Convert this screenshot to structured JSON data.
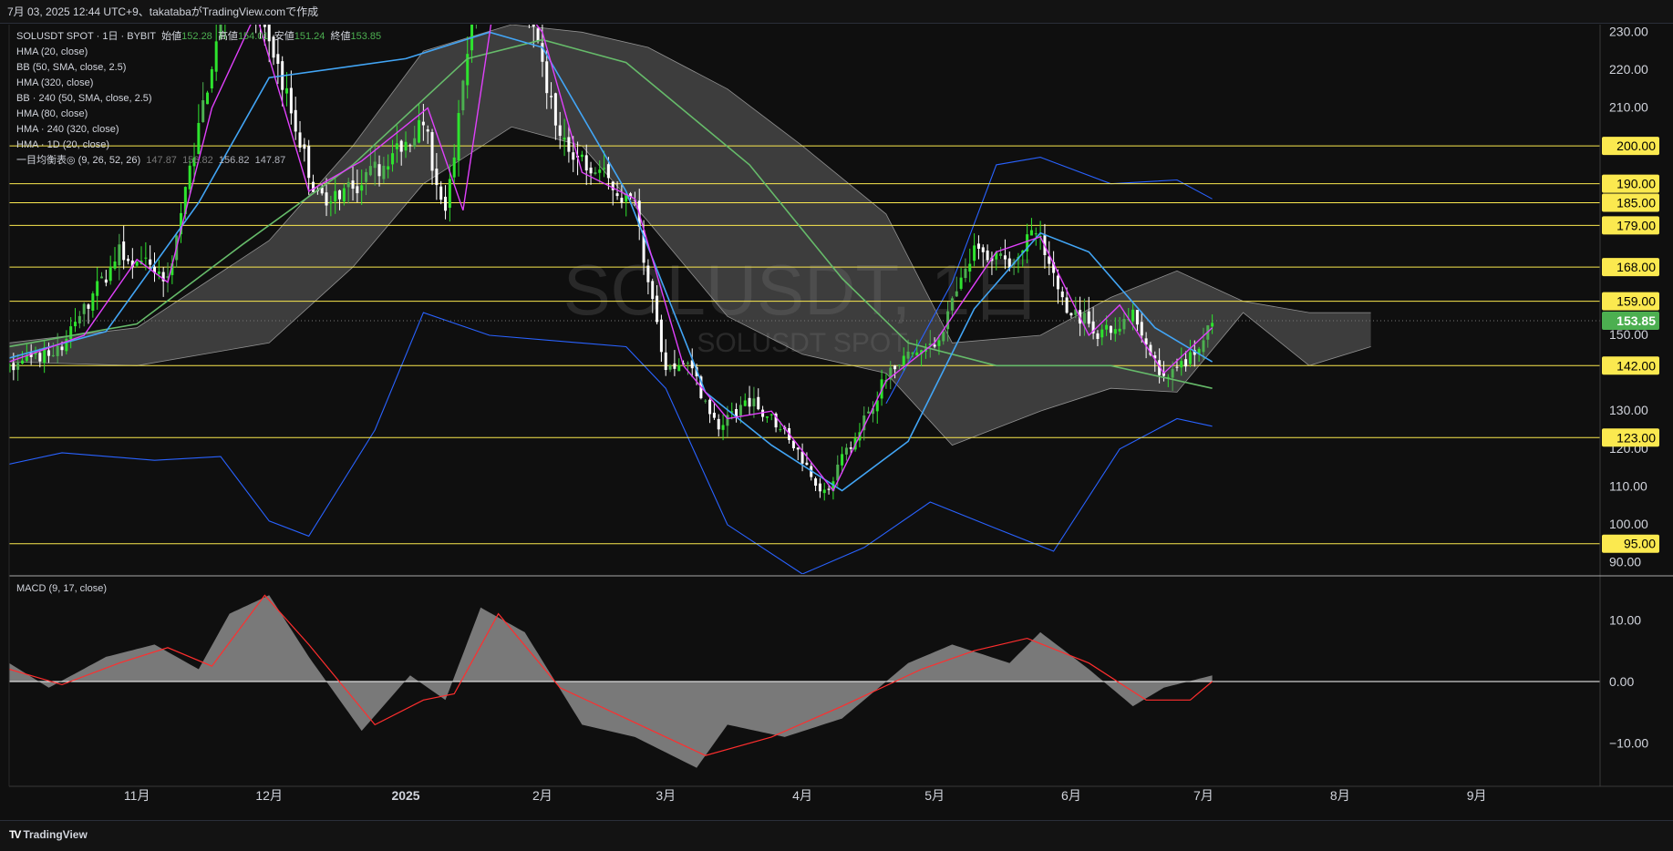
{
  "header": {
    "caption": "7月 03, 2025 12:44 UTC+9、takatabaがTradingView.comで作成"
  },
  "legend": {
    "symbol_line": "SOLUSDT SPOT · 1日 · BYBIT",
    "open_label": "始値",
    "open": "152.28",
    "high_label": "高値",
    "high": "154.01",
    "low_label": "安値",
    "low": "151.24",
    "close_label": "終値",
    "close": "153.85",
    "indicators": [
      "HMA (20, close)",
      "BB (50, SMA, close, 2.5)",
      "HMA (320, close)",
      "BB · 240 (50, SMA, close, 2.5)",
      "HMA (80, close)",
      "HMA · 240 (320, close)",
      "HMA · 1D (20, close)"
    ],
    "ichimoku_label": "一目均衡表◎ (9, 26, 52, 26)",
    "ichimoku_values": [
      "147.87",
      "156.82",
      "156.82",
      "147.87"
    ]
  },
  "watermark": {
    "big": "SOLUSDT, 1日",
    "small": "SOLUSDT SPOT"
  },
  "macd_label": "MACD (9, 17, close)",
  "footer": {
    "logo_text": "TradingView"
  },
  "colors": {
    "background": "#0f0f0f",
    "up": "#4caf50",
    "up_bright": "#2ee32e",
    "down": "#ffffff",
    "hma20": "#e040fb",
    "hma80": "#42a5f5",
    "hma320": "#66bb6a",
    "bb": "#2962ff",
    "level": "#fbe94f",
    "cloud": "#888888",
    "macd_signal": "#ff2e2e",
    "macd_hist": "#9e9e9e",
    "price_tag": "#4caf50"
  },
  "chart_data": {
    "type": "candlestick",
    "title": "SOLUSDT SPOT · 1日 · BYBIT",
    "price_axis": {
      "ticks": [
        230,
        220,
        210,
        200,
        190,
        180,
        170,
        160,
        150,
        140,
        130,
        120,
        110,
        100,
        90
      ],
      "tick_labels": [
        "230.00",
        "220.00",
        "210.00",
        "200.00",
        "",
        "",
        "",
        "",
        "150.00",
        "",
        "130.00",
        "120.00",
        "110.00",
        "100.00",
        "90.00"
      ],
      "ylim": [
        87,
        232
      ]
    },
    "time_axis": {
      "labels": [
        "11月",
        "12月",
        "2025",
        "2月",
        "3月",
        "4月",
        "5月",
        "6月",
        "7月",
        "8月",
        "9月"
      ],
      "positions": [
        "2024-11-01",
        "2024-12-01",
        "2025-01-01",
        "2025-02-01",
        "2025-03-01",
        "2025-04-01",
        "2025-05-01",
        "2025-06-01",
        "2025-07-01",
        "2025-08-01",
        "2025-09-01"
      ],
      "xlim": [
        "2024-10-03",
        "2025-09-29"
      ]
    },
    "horizontal_levels": [
      200,
      190,
      185,
      179,
      168,
      159,
      142,
      123,
      95
    ],
    "horizontal_level_labels": [
      "200.00",
      "190.00",
      "185.00",
      "179.00",
      "168.00",
      "159.00",
      "142.00",
      "123.00",
      "95.00"
    ],
    "last_price": 153.85,
    "last_price_label": "153.85",
    "price_path": [
      [
        "2024-10-03",
        141
      ],
      [
        "2024-10-15",
        147
      ],
      [
        "2024-10-28",
        172
      ],
      [
        "2024-11-08",
        165
      ],
      [
        "2024-11-22",
        245
      ],
      [
        "2024-12-01",
        228
      ],
      [
        "2024-12-12",
        186
      ],
      [
        "2024-12-22",
        190
      ],
      [
        "2025-01-05",
        206
      ],
      [
        "2025-01-10",
        181
      ],
      [
        "2025-01-19",
        258
      ],
      [
        "2025-01-28",
        238
      ],
      [
        "2025-02-05",
        202
      ],
      [
        "2025-02-15",
        192
      ],
      [
        "2025-02-22",
        183
      ],
      [
        "2025-03-01",
        141
      ],
      [
        "2025-03-06",
        143
      ],
      [
        "2025-03-13",
        125
      ],
      [
        "2025-03-20",
        133
      ],
      [
        "2025-03-28",
        125
      ],
      [
        "2025-04-06",
        108
      ],
      [
        "2025-04-13",
        124
      ],
      [
        "2025-04-22",
        143
      ],
      [
        "2025-05-01",
        147
      ],
      [
        "2025-05-10",
        172
      ],
      [
        "2025-05-18",
        170
      ],
      [
        "2025-05-24",
        177
      ],
      [
        "2025-05-30",
        159
      ],
      [
        "2025-06-08",
        150
      ],
      [
        "2025-06-15",
        155
      ],
      [
        "2025-06-22",
        138
      ],
      [
        "2025-06-27",
        143
      ],
      [
        "2025-07-03",
        153.85
      ]
    ],
    "hma20": [
      [
        "2024-10-03",
        143
      ],
      [
        "2024-10-20",
        150
      ],
      [
        "2024-11-01",
        170
      ],
      [
        "2024-11-08",
        164
      ],
      [
        "2024-11-18",
        210
      ],
      [
        "2024-11-28",
        235
      ],
      [
        "2024-12-10",
        188
      ],
      [
        "2024-12-22",
        196
      ],
      [
        "2025-01-06",
        210
      ],
      [
        "2025-01-14",
        183
      ],
      [
        "2025-01-22",
        245
      ],
      [
        "2025-02-01",
        230
      ],
      [
        "2025-02-10",
        193
      ],
      [
        "2025-02-22",
        186
      ],
      [
        "2025-03-05",
        142
      ],
      [
        "2025-03-15",
        128
      ],
      [
        "2025-03-25",
        130
      ],
      [
        "2025-04-08",
        109
      ],
      [
        "2025-04-20",
        138
      ],
      [
        "2025-05-01",
        148
      ],
      [
        "2025-05-15",
        172
      ],
      [
        "2025-05-25",
        176
      ],
      [
        "2025-06-05",
        150
      ],
      [
        "2025-06-12",
        158
      ],
      [
        "2025-06-22",
        140
      ],
      [
        "2025-07-03",
        152
      ]
    ],
    "hma80": [
      [
        "2024-10-03",
        144
      ],
      [
        "2024-10-25",
        151
      ],
      [
        "2024-11-15",
        185
      ],
      [
        "2024-12-01",
        218
      ],
      [
        "2025-01-01",
        223
      ],
      [
        "2025-01-20",
        230
      ],
      [
        "2025-02-01",
        226
      ],
      [
        "2025-02-20",
        188
      ],
      [
        "2025-03-10",
        135
      ],
      [
        "2025-03-25",
        121
      ],
      [
        "2025-04-10",
        109
      ],
      [
        "2025-04-25",
        122
      ],
      [
        "2025-05-10",
        157
      ],
      [
        "2025-05-25",
        177
      ],
      [
        "2025-06-05",
        172
      ],
      [
        "2025-06-20",
        152
      ],
      [
        "2025-07-03",
        143
      ]
    ],
    "hma320": [
      [
        "2024-10-03",
        147
      ],
      [
        "2024-11-01",
        153
      ],
      [
        "2024-11-25",
        174
      ],
      [
        "2024-12-20",
        195
      ],
      [
        "2025-01-15",
        223
      ],
      [
        "2025-02-01",
        228
      ],
      [
        "2025-02-20",
        222
      ],
      [
        "2025-03-20",
        195
      ],
      [
        "2025-04-10",
        165
      ],
      [
        "2025-04-25",
        148
      ],
      [
        "2025-05-15",
        142
      ],
      [
        "2025-06-10",
        142
      ],
      [
        "2025-07-03",
        136
      ]
    ],
    "bb_upper": [
      [
        "2025-04-20",
        132
      ],
      [
        "2025-05-05",
        164
      ],
      [
        "2025-05-15",
        195
      ],
      [
        "2025-05-25",
        197
      ],
      [
        "2025-06-10",
        190
      ],
      [
        "2025-06-25",
        191
      ],
      [
        "2025-07-03",
        186
      ]
    ],
    "bb_lower": [
      [
        "2024-10-03",
        116
      ],
      [
        "2024-10-15",
        119
      ],
      [
        "2024-11-05",
        117
      ],
      [
        "2024-11-20",
        118
      ],
      [
        "2024-12-01",
        101
      ],
      [
        "2024-12-10",
        97
      ],
      [
        "2024-12-25",
        125
      ],
      [
        "2025-01-05",
        156
      ],
      [
        "2025-01-20",
        150
      ],
      [
        "2025-02-20",
        147
      ],
      [
        "2025-03-01",
        136
      ],
      [
        "2025-03-15",
        100
      ],
      [
        "2025-04-01",
        87
      ],
      [
        "2025-04-15",
        94
      ],
      [
        "2025-04-30",
        106
      ],
      [
        "2025-05-15",
        99
      ],
      [
        "2025-05-28",
        93
      ],
      [
        "2025-06-12",
        120
      ],
      [
        "2025-06-25",
        128
      ],
      [
        "2025-07-03",
        126
      ]
    ],
    "cloud_upper": [
      [
        "2024-10-03",
        148
      ],
      [
        "2024-11-01",
        152
      ],
      [
        "2024-12-01",
        175
      ],
      [
        "2024-12-20",
        200
      ],
      [
        "2025-01-05",
        225
      ],
      [
        "2025-01-25",
        232
      ],
      [
        "2025-02-10",
        230
      ],
      [
        "2025-02-25",
        226
      ],
      [
        "2025-03-15",
        215
      ],
      [
        "2025-04-01",
        200
      ],
      [
        "2025-04-20",
        182
      ],
      [
        "2025-05-05",
        148
      ],
      [
        "2025-05-25",
        150
      ],
      [
        "2025-06-10",
        160
      ],
      [
        "2025-06-25",
        167
      ],
      [
        "2025-07-10",
        159
      ],
      [
        "2025-07-25",
        156
      ],
      [
        "2025-08-08",
        156
      ]
    ],
    "cloud_lower": [
      [
        "2024-10-03",
        143
      ],
      [
        "2024-11-01",
        142
      ],
      [
        "2024-12-01",
        148
      ],
      [
        "2024-12-20",
        168
      ],
      [
        "2025-01-05",
        190
      ],
      [
        "2025-01-25",
        205
      ],
      [
        "2025-02-10",
        200
      ],
      [
        "2025-02-25",
        180
      ],
      [
        "2025-03-15",
        155
      ],
      [
        "2025-04-01",
        145
      ],
      [
        "2025-04-20",
        140
      ],
      [
        "2025-05-05",
        121
      ],
      [
        "2025-05-25",
        130
      ],
      [
        "2025-06-10",
        136
      ],
      [
        "2025-06-25",
        135
      ],
      [
        "2025-07-10",
        156
      ],
      [
        "2025-07-25",
        142
      ],
      [
        "2025-08-08",
        147
      ]
    ],
    "macd_axis": {
      "ticks": [
        10,
        0,
        -10
      ],
      "tick_labels": [
        "10.00",
        "0.00",
        "−10.00"
      ],
      "ylim": [
        -17,
        17
      ]
    },
    "macd_hist": [
      [
        "2024-10-03",
        3
      ],
      [
        "2024-10-12",
        -1
      ],
      [
        "2024-10-25",
        4
      ],
      [
        "2024-11-05",
        6
      ],
      [
        "2024-11-15",
        2
      ],
      [
        "2024-11-22",
        11
      ],
      [
        "2024-12-01",
        14
      ],
      [
        "2024-12-10",
        4
      ],
      [
        "2024-12-22",
        -8
      ],
      [
        "2025-01-02",
        1
      ],
      [
        "2025-01-10",
        -3
      ],
      [
        "2025-01-18",
        12
      ],
      [
        "2025-01-28",
        8
      ],
      [
        "2025-02-10",
        -7
      ],
      [
        "2025-02-22",
        -9
      ],
      [
        "2025-03-08",
        -14
      ],
      [
        "2025-03-15",
        -7
      ],
      [
        "2025-03-28",
        -9
      ],
      [
        "2025-04-10",
        -6
      ],
      [
        "2025-04-25",
        3
      ],
      [
        "2025-05-05",
        6
      ],
      [
        "2025-05-18",
        3
      ],
      [
        "2025-05-25",
        8
      ],
      [
        "2025-06-05",
        2
      ],
      [
        "2025-06-15",
        -4
      ],
      [
        "2025-06-22",
        -1
      ],
      [
        "2025-07-03",
        1
      ]
    ],
    "macd_signal": [
      [
        "2024-10-03",
        2
      ],
      [
        "2024-10-15",
        -0.5
      ],
      [
        "2024-10-28",
        3
      ],
      [
        "2024-11-08",
        5.5
      ],
      [
        "2024-11-18",
        2.5
      ],
      [
        "2024-11-30",
        14
      ],
      [
        "2024-12-10",
        6
      ],
      [
        "2024-12-25",
        -7
      ],
      [
        "2025-01-05",
        -3
      ],
      [
        "2025-01-12",
        -2
      ],
      [
        "2025-01-22",
        11
      ],
      [
        "2025-02-05",
        -1
      ],
      [
        "2025-02-20",
        -6
      ],
      [
        "2025-03-10",
        -12
      ],
      [
        "2025-03-25",
        -9
      ],
      [
        "2025-04-10",
        -4
      ],
      [
        "2025-04-28",
        2
      ],
      [
        "2025-05-10",
        5
      ],
      [
        "2025-05-22",
        7
      ],
      [
        "2025-06-05",
        3
      ],
      [
        "2025-06-18",
        -3
      ],
      [
        "2025-06-28",
        -3
      ],
      [
        "2025-07-03",
        0
      ]
    ],
    "grid": false
  }
}
